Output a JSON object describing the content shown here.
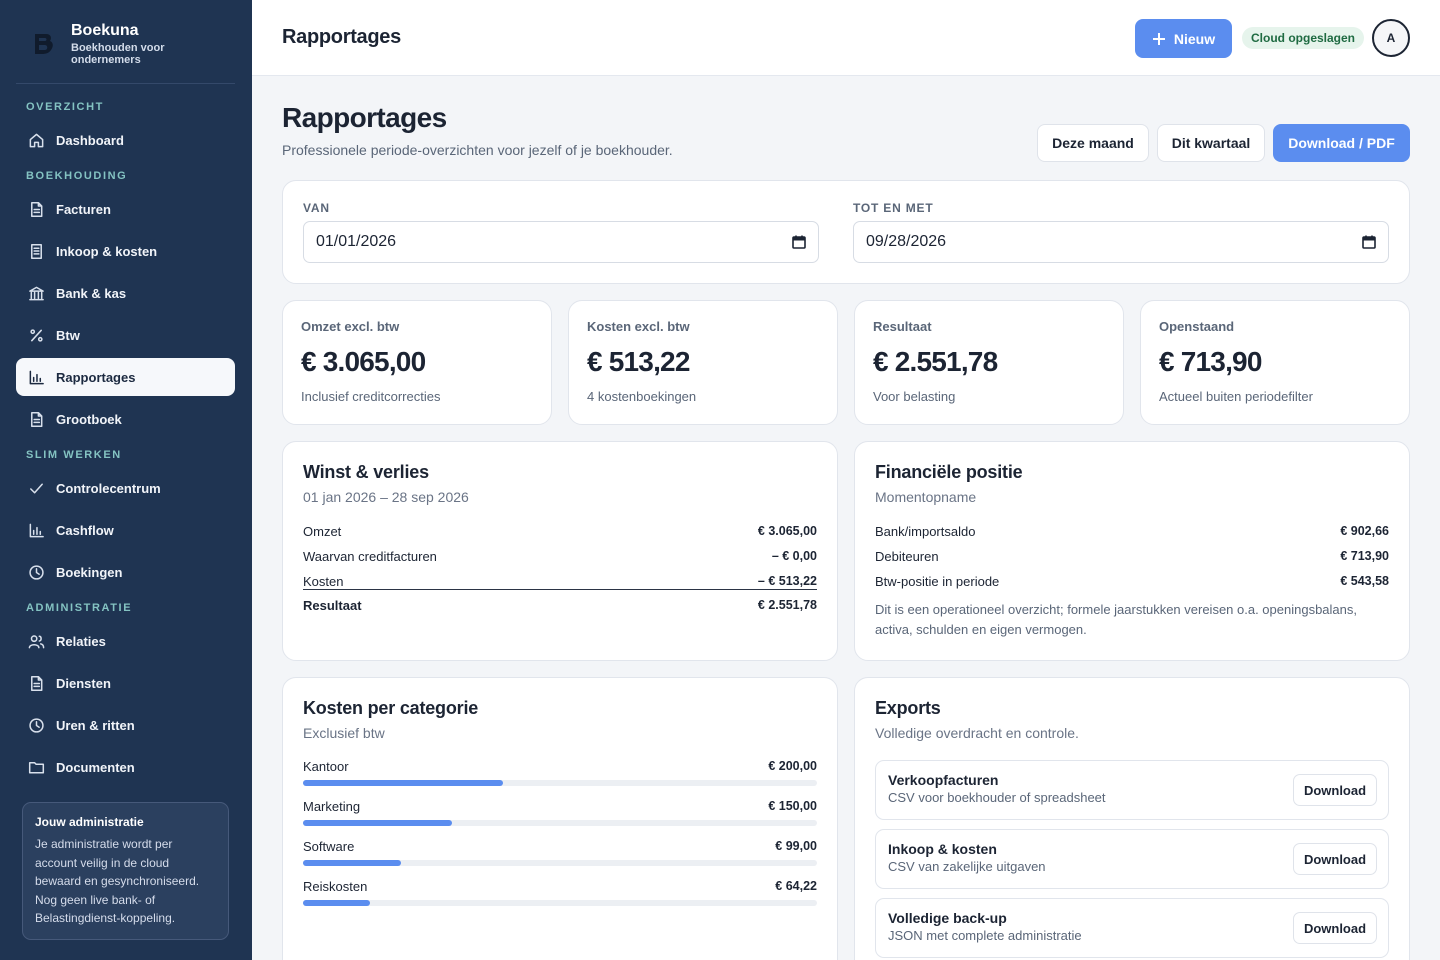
{
  "brand": {
    "name": "Boekuna",
    "tagline": "Boekhouden voor ondernemers"
  },
  "sidebar": {
    "sections": [
      {
        "label": "OVERZICHT",
        "items": [
          {
            "label": "Dashboard",
            "icon": "home-icon"
          }
        ]
      },
      {
        "label": "BOEKHOUDING",
        "items": [
          {
            "label": "Facturen",
            "icon": "document-icon"
          },
          {
            "label": "Inkoop & kosten",
            "icon": "receipt-icon"
          },
          {
            "label": "Bank & kas",
            "icon": "bank-icon"
          },
          {
            "label": "Btw",
            "icon": "percent-icon"
          },
          {
            "label": "Rapportages",
            "icon": "bar-chart-icon",
            "active": true
          },
          {
            "label": "Grootboek",
            "icon": "document-icon"
          }
        ]
      },
      {
        "label": "SLIM WERKEN",
        "items": [
          {
            "label": "Controlecentrum",
            "icon": "check-icon"
          },
          {
            "label": "Cashflow",
            "icon": "bar-chart-icon"
          },
          {
            "label": "Boekingen",
            "icon": "clock-icon"
          }
        ]
      },
      {
        "label": "ADMINISTRATIE",
        "items": [
          {
            "label": "Relaties",
            "icon": "users-icon"
          },
          {
            "label": "Diensten",
            "icon": "document-icon"
          },
          {
            "label": "Uren & ritten",
            "icon": "clock-icon"
          },
          {
            "label": "Documenten",
            "icon": "folder-icon"
          }
        ]
      }
    ],
    "info": {
      "title": "Jouw administratie",
      "text": "Je administratie wordt per account veilig in de cloud bewaard en gesynchroniseerd. Nog geen live bank- of Belastingdienst-koppeling."
    }
  },
  "topbar": {
    "title": "Rapportages",
    "new_label": "Nieuw",
    "cloud_status": "Cloud opgeslagen",
    "avatar_initial": "A"
  },
  "page": {
    "title": "Rapportages",
    "subtitle": "Professionele periode-overzichten voor jezelf of je boekhouder.",
    "buttons": {
      "month": "Deze maand",
      "quarter": "Dit kwartaal",
      "download": "Download / PDF"
    }
  },
  "period": {
    "from_label": "VAN",
    "from_value": "01/01/2026",
    "to_label": "TOT EN MET",
    "to_value": "09/28/2026"
  },
  "stats": [
    {
      "label": "Omzet excl. btw",
      "value": "€ 3.065,00",
      "note": "Inclusief creditcorrecties"
    },
    {
      "label": "Kosten excl. btw",
      "value": "€ 513,22",
      "note": "4 kostenboekingen"
    },
    {
      "label": "Resultaat",
      "value": "€ 2.551,78",
      "note": "Voor belasting"
    },
    {
      "label": "Openstaand",
      "value": "€ 713,90",
      "note": "Actueel buiten periodefilter"
    }
  ],
  "pnl": {
    "title": "Winst & verlies",
    "period": "01 jan 2026 – 28 sep 2026",
    "rows": [
      {
        "label": "Omzet",
        "value": "€ 3.065,00"
      },
      {
        "label": "Waarvan creditfacturen",
        "value": "– € 0,00"
      },
      {
        "label": "Kosten",
        "value": "– € 513,22"
      },
      {
        "label": "Resultaat",
        "value": "€ 2.551,78"
      }
    ]
  },
  "position": {
    "title": "Financiële positie",
    "subtitle": "Momentopname",
    "rows": [
      {
        "label": "Bank/importsaldo",
        "value": "€ 902,66"
      },
      {
        "label": "Debiteuren",
        "value": "€ 713,90"
      },
      {
        "label": "Btw-positie in periode",
        "value": "€ 543,58"
      }
    ],
    "note": "Dit is een operationeel overzicht; formele jaarstukken vereisen o.a. openingsbalans, activa, schulden en eigen vermogen."
  },
  "categories": {
    "title": "Kosten per categorie",
    "subtitle": "Exclusief btw",
    "items": [
      {
        "label": "Kantoor",
        "value": "€ 200,00",
        "share": 0.39
      },
      {
        "label": "Marketing",
        "value": "€ 150,00",
        "share": 0.29
      },
      {
        "label": "Software",
        "value": "€ 99,00",
        "share": 0.19
      },
      {
        "label": "Reiskosten",
        "value": "€ 64,22",
        "share": 0.13
      }
    ]
  },
  "exports": {
    "title": "Exports",
    "subtitle": "Volledige overdracht en controle.",
    "items": [
      {
        "title": "Verkoopfacturen",
        "desc": "CSV voor boekhouder of spreadsheet",
        "button": "Download"
      },
      {
        "title": "Inkoop & kosten",
        "desc": "CSV van zakelijke uitgaven",
        "button": "Download"
      },
      {
        "title": "Volledige back-up",
        "desc": "JSON met complete administratie",
        "button": "Download"
      }
    ]
  },
  "colors": {
    "sidebar_bg": "#1f3452",
    "accent": "#5b8def",
    "section_label": "#84c3c2",
    "cloud_badge_bg": "#e6f4ec",
    "cloud_badge_text": "#1f6b42"
  }
}
